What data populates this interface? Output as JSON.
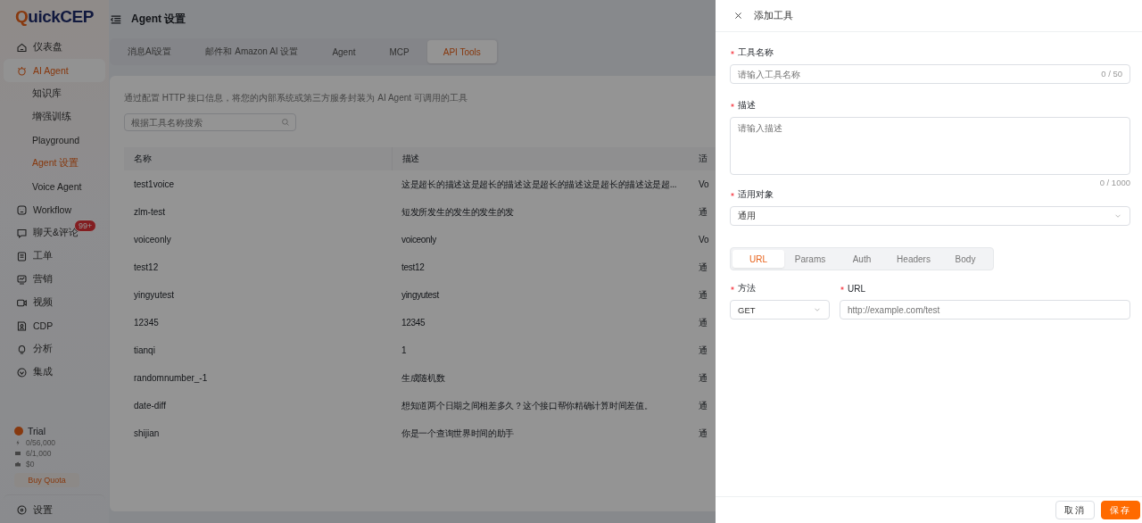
{
  "logo": "QuickCEP",
  "sidebar": {
    "items": [
      {
        "label": "仪表盘",
        "selected": false
      },
      {
        "label": "AI Agent",
        "selected": true,
        "children": [
          {
            "label": "知识库",
            "selected": false
          },
          {
            "label": "增强训练",
            "selected": false
          },
          {
            "label": "Playground",
            "selected": false
          },
          {
            "label": "Agent 设置",
            "selected": true
          },
          {
            "label": "Voice Agent",
            "selected": false
          }
        ]
      },
      {
        "label": "Workflow",
        "selected": false
      },
      {
        "label": "聊天&评论",
        "selected": false,
        "badge": "99+"
      },
      {
        "label": "工单",
        "selected": false
      },
      {
        "label": "营销",
        "selected": false
      },
      {
        "label": "视频",
        "selected": false
      },
      {
        "label": "CDP",
        "selected": false
      },
      {
        "label": "分析",
        "selected": false
      },
      {
        "label": "集成",
        "selected": false
      }
    ],
    "plan": {
      "name": "Trial",
      "stats": [
        "0/56,000",
        "6/1,000",
        "$0"
      ],
      "button": "Buy Quota"
    },
    "settings": "设置"
  },
  "header": {
    "title": "Agent 设置"
  },
  "tabs": [
    {
      "label": "消息AI设置",
      "selected": false
    },
    {
      "label": "邮件和 Amazon AI 设置",
      "selected": false
    },
    {
      "label": "Agent",
      "selected": false
    },
    {
      "label": "MCP",
      "selected": false
    },
    {
      "label": "API Tools",
      "selected": true
    }
  ],
  "description": "通过配置 HTTP 接口信息，将您的内部系统或第三方服务封装为 AI Agent 可调用的工具",
  "search": {
    "placeholder": "根据工具名称搜索"
  },
  "table": {
    "columns": [
      "名称",
      "描述",
      "适"
    ],
    "rows": [
      [
        "test1voice",
        "这是超长的描述这是超长的描述这是超长的描述这是超长的描述这是超...",
        "Vo"
      ],
      [
        "zlm-test",
        "短发所发生的发生的发生的发",
        "通"
      ],
      [
        "voiceonly",
        "voiceonly",
        "Vo"
      ],
      [
        "test12",
        "test12",
        "通"
      ],
      [
        "yingyutest",
        "yingyutest",
        "通"
      ],
      [
        "12345",
        "12345",
        "通"
      ],
      [
        "tianqi",
        "1",
        "通"
      ],
      [
        "randomnumber_-1",
        "生成随机数",
        "通"
      ],
      [
        "date-diff",
        "想知道两个日期之间相差多久？这个接口帮你精确计算时间差值。",
        "通"
      ],
      [
        "shijian",
        "你是一个查询世界时间的助手",
        "通"
      ]
    ]
  },
  "drawer": {
    "title": "添加工具",
    "name_field": {
      "label": "工具名称",
      "required": true,
      "placeholder": "请输入工具名称",
      "counter": "0 / 50"
    },
    "description_field": {
      "label": "描述",
      "required": true,
      "placeholder": "请输入描述",
      "counter": "0 / 1000"
    },
    "target_field": {
      "label": "适用对象",
      "required": true,
      "value": "通用"
    },
    "request_tabs": [
      {
        "label": "URL",
        "selected": true
      },
      {
        "label": "Params",
        "selected": false
      },
      {
        "label": "Auth",
        "selected": false
      },
      {
        "label": "Headers",
        "selected": false
      },
      {
        "label": "Body",
        "selected": false
      }
    ],
    "method_field": {
      "label": "方法",
      "required": true,
      "value": "GET"
    },
    "url_field": {
      "label": "URL",
      "required": true,
      "placeholder": "http://example.com/test"
    },
    "buttons": [
      {
        "label": "取消",
        "kind": "secondary"
      },
      {
        "label": "保存",
        "kind": "primary"
      }
    ]
  }
}
